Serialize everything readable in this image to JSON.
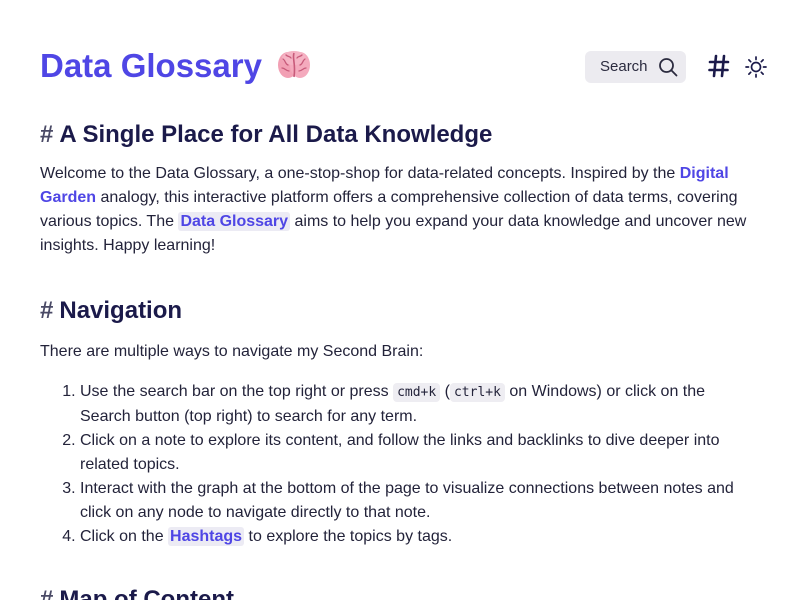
{
  "header": {
    "title": "Data Glossary",
    "search_label": "Search",
    "hash_label": "#"
  },
  "icons": {
    "brain": "brain-icon",
    "search": "search-icon",
    "hashtag": "hashtag-icon",
    "theme": "sun-icon"
  },
  "colors": {
    "accent": "#4f46e5",
    "heading": "#1b1a4a",
    "highlight": "#ecebf4"
  },
  "sections": [
    {
      "title": "A Single Place for All Data Knowledge",
      "paragraph": {
        "t1": "Welcome to the Data Glossary, a one-stop-shop for data-related concepts. Inspired by the ",
        "link1": "Digital Garden",
        "t2": " analogy, this interactive platform offers a comprehensive collection of data terms, covering various topics. The ",
        "link2": "Data Glossary",
        "t3": " aims to help you expand your data knowledge and uncover new insights. Happy learning!"
      }
    },
    {
      "title": "Navigation",
      "lead": "There are multiple ways to navigate my Second Brain:",
      "items": [
        {
          "t1": "Use the search bar on the top right or press ",
          "code1": "cmd+k",
          "t2": " (",
          "code2": "ctrl+k",
          "t3": " on Windows) or click on the Search button (top right) to search for any term."
        },
        {
          "text": "Click on a note to explore its content, and follow the links and backlinks to dive deeper into related topics."
        },
        {
          "text": "Interact with the graph at the bottom of the page to visualize connections between notes and click on any node to navigate directly to that note."
        },
        {
          "t1": "Click on the ",
          "link": "Hashtags",
          "t2": " to explore the topics by tags."
        }
      ]
    },
    {
      "title": "Map of Content"
    }
  ]
}
